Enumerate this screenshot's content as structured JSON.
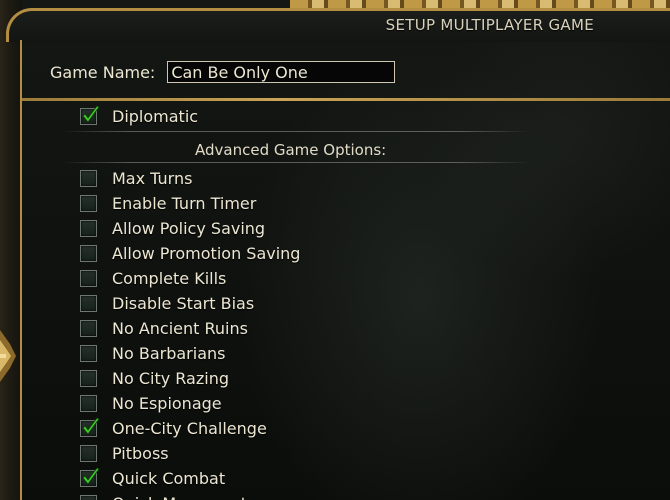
{
  "window": {
    "title": "SETUP MULTIPLAYER GAME"
  },
  "game_name": {
    "label": "Game Name:",
    "value": "Can Be Only One"
  },
  "top_options": [
    {
      "label": "Diplomatic",
      "checked": true
    }
  ],
  "advanced": {
    "header": "Advanced Game Options:",
    "options": [
      {
        "label": "Max Turns",
        "checked": false
      },
      {
        "label": "Enable Turn Timer",
        "checked": false
      },
      {
        "label": "Allow Policy Saving",
        "checked": false
      },
      {
        "label": "Allow Promotion Saving",
        "checked": false
      },
      {
        "label": "Complete Kills",
        "checked": false
      },
      {
        "label": "Disable Start Bias",
        "checked": false
      },
      {
        "label": "No Ancient Ruins",
        "checked": false
      },
      {
        "label": "No Barbarians",
        "checked": false
      },
      {
        "label": "No City Razing",
        "checked": false
      },
      {
        "label": "No Espionage",
        "checked": false
      },
      {
        "label": "One-City Challenge",
        "checked": true
      },
      {
        "label": "Pitboss",
        "checked": false
      },
      {
        "label": "Quick Combat",
        "checked": true
      },
      {
        "label": "Quick Movement",
        "checked": false
      }
    ]
  },
  "colors": {
    "frame_gold": "#b38d42",
    "text": "#ece6d2",
    "check_green": "#3fd02a"
  }
}
